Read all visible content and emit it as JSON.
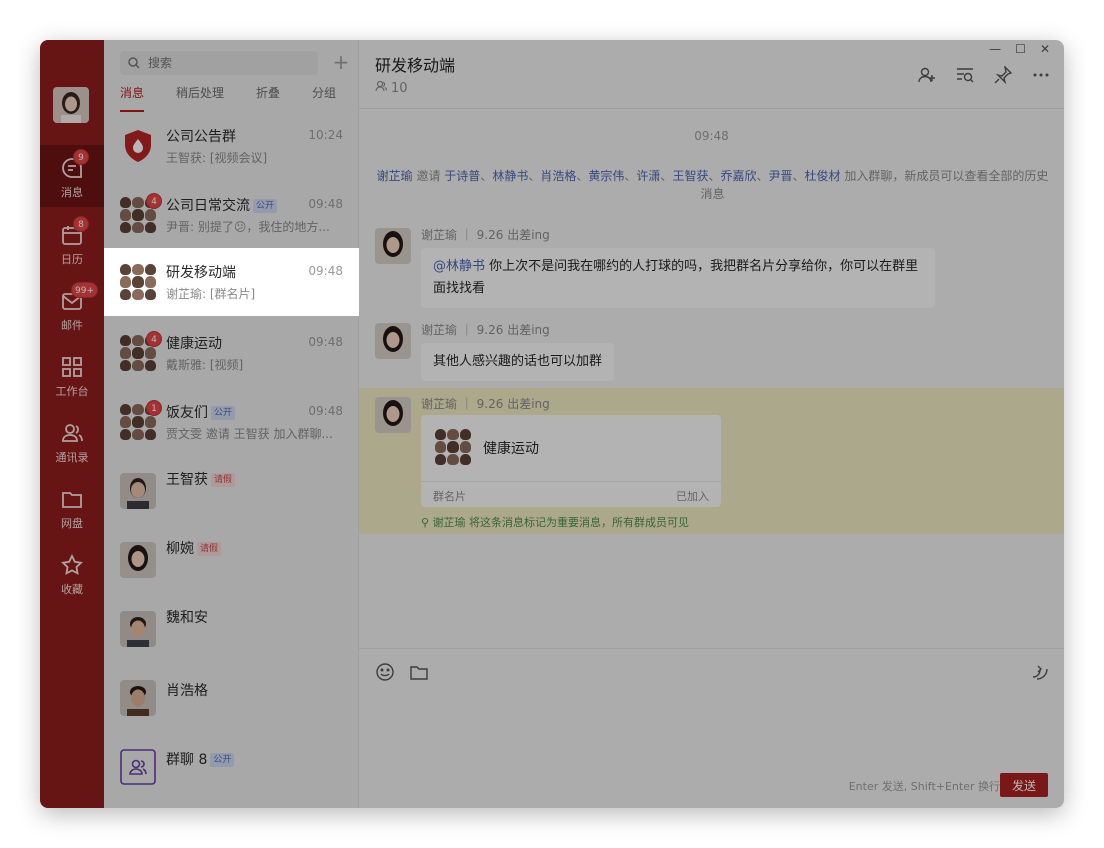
{
  "app": {
    "rail": {
      "items": [
        {
          "label": "消息",
          "badge": "9"
        },
        {
          "label": "日历",
          "badge": "8"
        },
        {
          "label": "邮件",
          "badge": "99+"
        },
        {
          "label": "工作台",
          "badge": ""
        },
        {
          "label": "通讯录",
          "badge": ""
        },
        {
          "label": "网盘",
          "badge": ""
        },
        {
          "label": "收藏",
          "badge": ""
        }
      ]
    },
    "list": {
      "search_placeholder": "搜索",
      "tabs": [
        "消息",
        "稍后处理",
        "折叠",
        "分组"
      ],
      "conversations": [
        {
          "name": "公司公告群",
          "time": "10:24",
          "preview": "王智获: [视频会议]",
          "badge": "",
          "tag": ""
        },
        {
          "name": "公司日常交流",
          "time": "09:48",
          "preview": "尹晋: 别提了😕，我住的地方...",
          "badge": "4",
          "tag": "公开"
        },
        {
          "name": "研发移动端",
          "time": "09:48",
          "preview": "谢芷瑜: [群名片]",
          "badge": "",
          "tag": ""
        },
        {
          "name": "健康运动",
          "time": "09:48",
          "preview": "戴斯雅: [视频]",
          "badge": "4",
          "tag": ""
        },
        {
          "name": "饭友们",
          "time": "09:48",
          "preview": "贾文雯 邀请 王智获 加入群聊...",
          "badge": "1",
          "tag": "公开"
        },
        {
          "name": "王智获",
          "time": "",
          "preview": "",
          "badge": "",
          "tag": "请假"
        },
        {
          "name": "柳婉",
          "time": "",
          "preview": "",
          "badge": "",
          "tag": "请假"
        },
        {
          "name": "魏和安",
          "time": "",
          "preview": "",
          "badge": "",
          "tag": ""
        },
        {
          "name": "肖浩格",
          "time": "",
          "preview": "",
          "badge": "",
          "tag": ""
        },
        {
          "name": "群聊 8",
          "time": "",
          "preview": "",
          "badge": "",
          "tag": "公开"
        }
      ]
    },
    "chat": {
      "title": "研发移动端",
      "member_count": "10",
      "time_divider": "09:48",
      "system": {
        "inviter": "谢芷瑜",
        "verb": " 邀请 ",
        "invitees": [
          "于诗普",
          "林静书",
          "肖浩格",
          "黄宗伟",
          "许潇",
          "王智获",
          "乔嘉欣",
          "尹晋",
          "杜俊材"
        ],
        "sep": "、",
        "suffix": " 加入群聊，新成员可以查看全部的历史消息"
      },
      "messages": [
        {
          "sender": "谢芷瑜",
          "status": "9.26 出差ing",
          "mention": "@林静书",
          "text": " 你上次不是问我在哪约的人打球的吗，我把群名片分享给你，你可以在群里面找找看"
        },
        {
          "sender": "谢芷瑜",
          "status": "9.26 出差ing",
          "text": "其他人感兴趣的话也可以加群"
        },
        {
          "sender": "谢芷瑜",
          "status": "9.26 出差ing",
          "card": {
            "name": "健康运动",
            "footer_left": "群名片",
            "footer_right": "已加入"
          }
        }
      ],
      "pin_note": "谢芷瑜 将这条消息标记为重要消息，所有群成员可见",
      "hint": "Enter 发送, Shift+Enter 换行",
      "send_label": "发送"
    }
  }
}
